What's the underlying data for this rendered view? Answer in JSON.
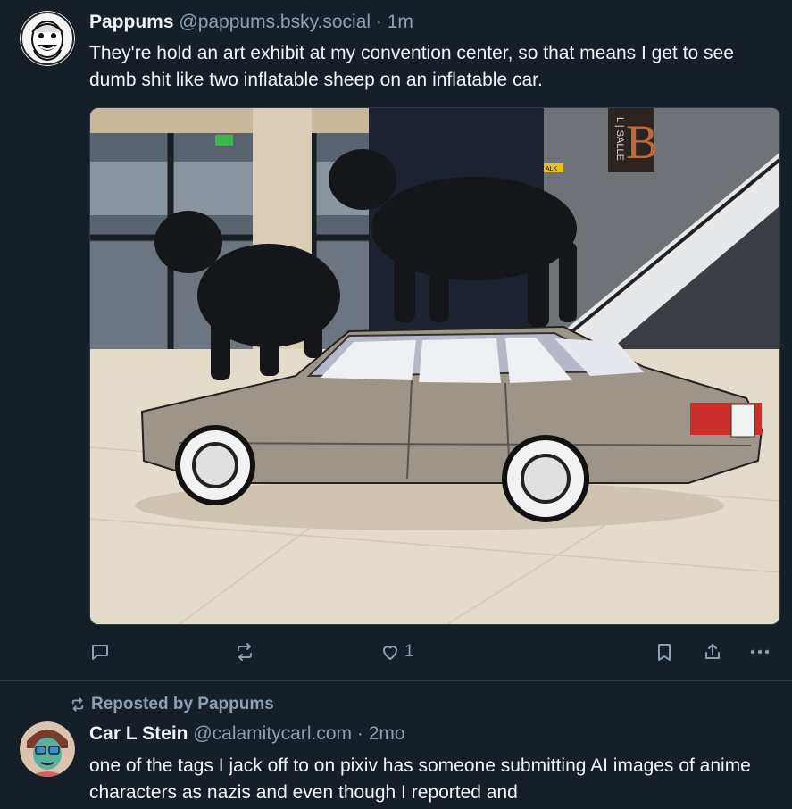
{
  "post1": {
    "author_name": "Pappums",
    "author_handle": "@pappums.bsky.social",
    "separator": "·",
    "time": "1m",
    "text": "They're hold an art exhibit at my convention center, so that means I get to see dumb shit like two inflatable sheep on an inflatable car.",
    "photo_sign": "L | SALLE",
    "photo_sign_letter": "B",
    "photo_tag": "ALK",
    "like_count": "1"
  },
  "post2": {
    "repost_label": "Reposted by Pappums",
    "author_name": "Car L Stein",
    "author_handle": "@calamitycarl.com",
    "separator": "·",
    "time": "2mo",
    "text": "one of the tags I jack off to on pixiv has someone submitting AI images of anime characters as nazis and even though I reported and"
  },
  "colors": {
    "background": "#161e27",
    "muted": "#8da0b3",
    "accent": "#1083fe"
  }
}
